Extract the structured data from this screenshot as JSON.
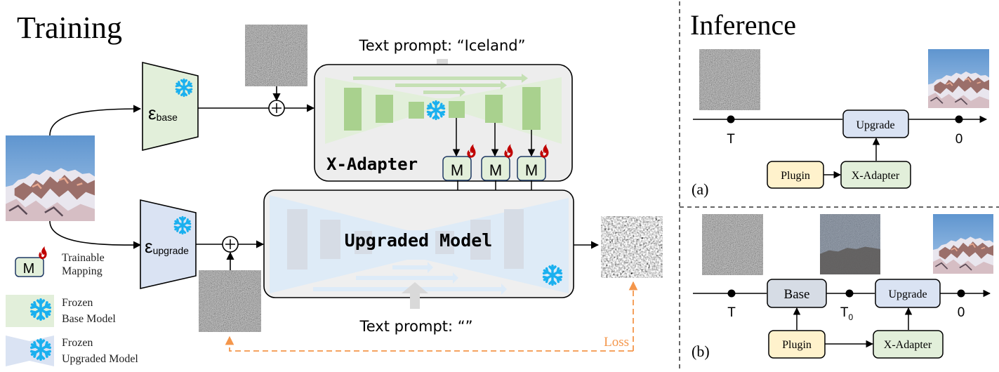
{
  "training": {
    "title": "Training",
    "encoders": {
      "base": {
        "symbol": "ε",
        "subscript": "base"
      },
      "upgrade": {
        "symbol": "ε",
        "subscript": "upgrade"
      }
    },
    "x_adapter": {
      "label": "X-Adapter",
      "text_prompt": "Text prompt: “Iceland”",
      "mapping_label": "M",
      "mapping_count": 3
    },
    "upgraded_model": {
      "label": "Upgraded Model",
      "text_prompt": "Text prompt: “”"
    },
    "loss_label": "Loss",
    "plus_symbol": "+",
    "legend": [
      {
        "icon": "trainable-mapping-icon",
        "line1": "Trainable",
        "line2": "Mapping"
      },
      {
        "icon": "frozen-base-model-icon",
        "line1": "Frozen",
        "line2": "Base Model"
      },
      {
        "icon": "frozen-upgraded-model-icon",
        "line1": "Frozen",
        "line2": "Upgraded Model"
      }
    ]
  },
  "inference": {
    "title": "Inference",
    "panel_a": {
      "tag": "(a)",
      "t_start": "T",
      "t_end": "0",
      "upgrade_label": "Upgrade",
      "plugin_label": "Plugin",
      "adapter_label": "X-Adapter"
    },
    "panel_b": {
      "tag": "(b)",
      "t_start": "T",
      "t_mid": "T",
      "t_mid_sub": "0",
      "t_end": "0",
      "base_label": "Base",
      "upgrade_label": "Upgrade",
      "plugin_label": "Plugin",
      "adapter_label": "X-Adapter"
    }
  },
  "colors": {
    "green_fill": "#e2efda",
    "green_block": "#a9d18e",
    "green_light": "#c5e0b4",
    "blue_fill": "#dae3f3",
    "blue_light": "#deebf7",
    "gray_block": "#d6dce5",
    "container_fill": "#ededed",
    "yellow_fill": "#fff2cc",
    "snowflake": "#1ab0ef",
    "fire": "#c00000",
    "loss": "#f4964b",
    "noise": "#5a5a5a",
    "sky": "#7ea9d8"
  }
}
